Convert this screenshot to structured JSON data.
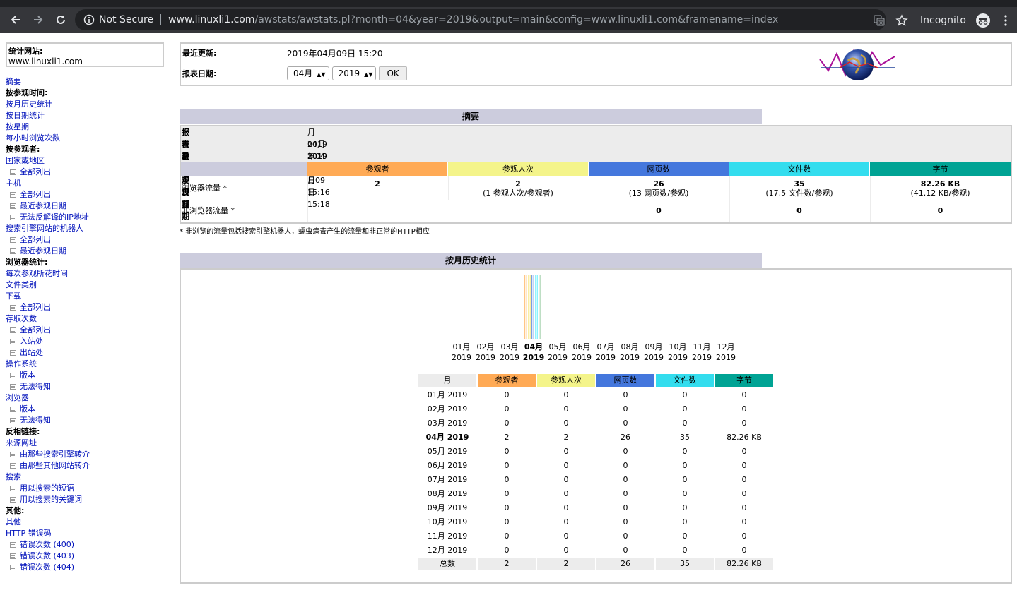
{
  "browser": {
    "security_label": "Not Secure",
    "url_host": "www.linuxli1.com",
    "url_path": "/awstats/awstats.pl?month=04&year=2019&output=main&config=www.linuxli1.com&framename=index",
    "incognito_label": "Incognito"
  },
  "sidebar": {
    "site_label": "统计网站:",
    "site_value": "www.linuxli1.com",
    "items": [
      {
        "label": "摘要",
        "kind": "link"
      },
      {
        "label": "按参观时间:",
        "kind": "head"
      },
      {
        "label": "按月历史统计",
        "kind": "link"
      },
      {
        "label": "按日期统计",
        "kind": "link"
      },
      {
        "label": "按星期",
        "kind": "link"
      },
      {
        "label": "每小时浏览次数",
        "kind": "link"
      },
      {
        "label": "按参观者:",
        "kind": "head"
      },
      {
        "label": "国家或地区",
        "kind": "link"
      },
      {
        "label": "全部列出",
        "kind": "sub"
      },
      {
        "label": "主机",
        "kind": "link"
      },
      {
        "label": "全部列出",
        "kind": "sub"
      },
      {
        "label": "最近参观日期",
        "kind": "sub"
      },
      {
        "label": "无法反解译的IP地址",
        "kind": "sub"
      },
      {
        "label": "搜索引擎网站的机器人",
        "kind": "link"
      },
      {
        "label": "全部列出",
        "kind": "sub"
      },
      {
        "label": "最近参观日期",
        "kind": "sub"
      },
      {
        "label": "浏览器统计:",
        "kind": "head"
      },
      {
        "label": "每次参观所花时间",
        "kind": "link"
      },
      {
        "label": "文件类别",
        "kind": "link"
      },
      {
        "label": "下载",
        "kind": "link"
      },
      {
        "label": "全部列出",
        "kind": "sub"
      },
      {
        "label": "存取次数",
        "kind": "link"
      },
      {
        "label": "全部列出",
        "kind": "sub"
      },
      {
        "label": "入站处",
        "kind": "sub"
      },
      {
        "label": "出站处",
        "kind": "sub"
      },
      {
        "label": "操作系统",
        "kind": "link"
      },
      {
        "label": "版本",
        "kind": "sub"
      },
      {
        "label": "无法得知",
        "kind": "sub"
      },
      {
        "label": "浏览器",
        "kind": "link"
      },
      {
        "label": "版本",
        "kind": "sub"
      },
      {
        "label": "无法得知",
        "kind": "sub"
      },
      {
        "label": "反相链接:",
        "kind": "head"
      },
      {
        "label": "来源网址",
        "kind": "link"
      },
      {
        "label": "由那些搜索引擎转介",
        "kind": "sub"
      },
      {
        "label": "由那些其他网站转介",
        "kind": "sub"
      },
      {
        "label": "搜索",
        "kind": "link"
      },
      {
        "label": "用以搜索的短语",
        "kind": "sub"
      },
      {
        "label": "用以搜索的关键词",
        "kind": "sub"
      },
      {
        "label": "其他:",
        "kind": "head"
      },
      {
        "label": "其他",
        "kind": "link"
      },
      {
        "label": "HTTP 错误码",
        "kind": "link"
      },
      {
        "label": "错误次数 (400)",
        "kind": "sub"
      },
      {
        "label": "错误次数 (403)",
        "kind": "sub"
      },
      {
        "label": "错误次数 (404)",
        "kind": "sub"
      }
    ]
  },
  "header": {
    "last_update_label": "最近更新:",
    "last_update_value": "2019年04月09日 15:20",
    "report_date_label": "报表日期:",
    "month_select": "04月",
    "year_select": "2019",
    "ok_label": "OK"
  },
  "summary": {
    "title": "摘要",
    "period_label": "报表日期",
    "period_value": "月 04月 2019",
    "first_visit_label": "首次参观日期",
    "first_visit_value": "2019年04月09日 15:16",
    "last_visit_label": "最近参观日期",
    "last_visit_value": "2019年04月09日 15:18",
    "columns": [
      "参观者",
      "参观人次",
      "网页数",
      "文件数",
      "字节"
    ],
    "viewed_label": "浏览器流量 *",
    "viewed": {
      "visitors": "2",
      "visits": "2",
      "visits_sub": "(1 参观人次/参观者)",
      "pages": "26",
      "pages_sub": "(13 网页数/参观)",
      "hits": "35",
      "hits_sub": "(17.5 文件数/参观)",
      "bytes": "82.26 KB",
      "bytes_sub": "(41.12 KB/参观)"
    },
    "notviewed_label": "非浏览器流量 *",
    "notviewed": {
      "pages": "0",
      "hits": "0",
      "bytes": "0"
    },
    "footnote": "* 非浏览的流量包括搜索引擎机器人，蠕虫病毒产生的流量和非正常的HTTP相应"
  },
  "history": {
    "title": "按月历史统计",
    "table_headers": [
      "月",
      "参观者",
      "参观人次",
      "网页数",
      "文件数",
      "字节"
    ],
    "total_label": "总数",
    "totals": [
      "2",
      "2",
      "26",
      "35",
      "82.26 KB"
    ],
    "current_month_index": 3
  },
  "chart_data": {
    "type": "bar",
    "categories": [
      "01月 2019",
      "02月 2019",
      "03月 2019",
      "04月 2019",
      "05月 2019",
      "06月 2019",
      "07月 2019",
      "08月 2019",
      "09月 2019",
      "10月 2019",
      "11月 2019",
      "12月 2019"
    ],
    "month_labels": [
      "01月",
      "02月",
      "03月",
      "04月",
      "05月",
      "06月",
      "07月",
      "08月",
      "09月",
      "10月",
      "11月",
      "12月"
    ],
    "year_labels": [
      "2019",
      "2019",
      "2019",
      "2019",
      "2019",
      "2019",
      "2019",
      "2019",
      "2019",
      "2019",
      "2019",
      "2019"
    ],
    "series": [
      {
        "name": "参观者",
        "color": "#ffb055",
        "values": [
          0,
          0,
          0,
          2,
          0,
          0,
          0,
          0,
          0,
          0,
          0,
          0
        ]
      },
      {
        "name": "参观人次",
        "color": "#f8e880",
        "values": [
          0,
          0,
          0,
          2,
          0,
          0,
          0,
          0,
          0,
          0,
          0,
          0
        ]
      },
      {
        "name": "网页数",
        "color": "#4477dd",
        "values": [
          0,
          0,
          0,
          26,
          0,
          0,
          0,
          0,
          0,
          0,
          0,
          0
        ]
      },
      {
        "name": "文件数",
        "color": "#66f0ff",
        "values": [
          0,
          0,
          0,
          35,
          0,
          0,
          0,
          0,
          0,
          0,
          0,
          0
        ]
      },
      {
        "name": "字节",
        "color": "#339944",
        "values": [
          0,
          0,
          0,
          82.26,
          0,
          0,
          0,
          0,
          0,
          0,
          0,
          0
        ]
      }
    ],
    "bytes_display": [
      "0",
      "0",
      "0",
      "82.26 KB",
      "0",
      "0",
      "0",
      "0",
      "0",
      "0",
      "0",
      "0"
    ]
  },
  "colors": {
    "visitors": "#ffb055",
    "visits": "#f8e880",
    "pages": "#4477dd",
    "hits": "#66f0ff",
    "bytes": "#2ea495",
    "title_bar": "#ccccdd",
    "link": "#0011bb"
  }
}
